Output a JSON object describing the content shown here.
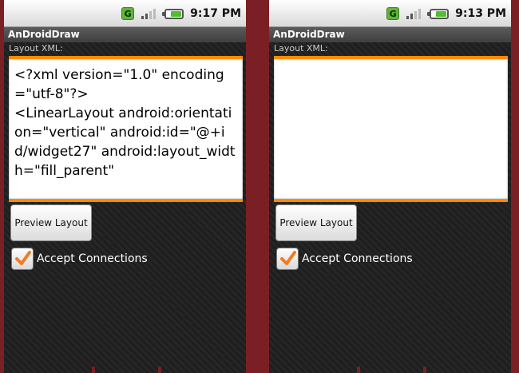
{
  "screens": [
    {
      "status": {
        "time": "9:17 PM",
        "network_badge": "G"
      },
      "app_title": "AnDroidDraw",
      "section_label": "Layout XML:",
      "xml_text": "<?xml version=\"1.0\" encoding=\"utf-8\"?>\n<LinearLayout android:orientation=\"vertical\" android:id=\"@+id/widget27\" android:layout_width=\"fill_parent\"",
      "preview_button_label": "Preview Layout",
      "accept_connections_label": "Accept Connections",
      "accept_connections_checked": true
    },
    {
      "status": {
        "time": "9:13 PM",
        "network_badge": "G"
      },
      "app_title": "AnDroidDraw",
      "section_label": "Layout XML:",
      "xml_text": "",
      "preview_button_label": "Preview Layout",
      "accept_connections_label": "Accept Connections",
      "accept_connections_checked": true
    }
  ],
  "colors": {
    "accent_orange": "#ff8a00",
    "checkmark_orange": "#f47a1f",
    "bezel": "#7a1f24",
    "battery_green": "#4ec02b"
  },
  "icons": [
    "network-g-icon",
    "signal-strength-icon",
    "battery-icon",
    "checkmark-icon"
  ]
}
